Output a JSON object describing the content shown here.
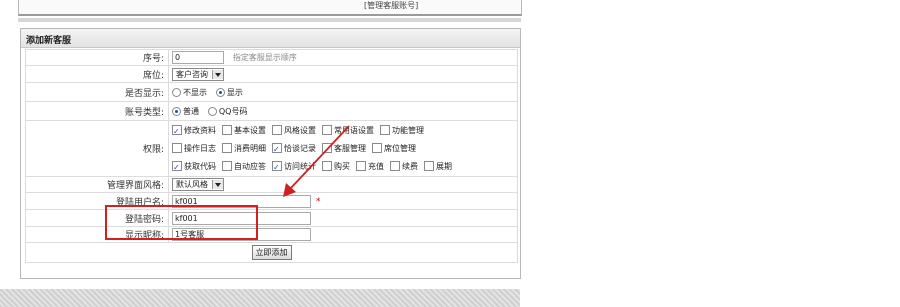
{
  "top": {
    "link": "[管理客服账号]"
  },
  "panel": {
    "title": "添加新客服"
  },
  "fields": {
    "seq": {
      "label": "序号:",
      "value": "0",
      "hint": "指定客服显示顺序"
    },
    "seat": {
      "label": "席位:",
      "value": "客户咨询"
    },
    "display": {
      "label": "是否显示:",
      "options": [
        "不显示",
        "显示"
      ],
      "selected": "显示"
    },
    "account_type": {
      "label": "账号类型:",
      "options": [
        "普通",
        "QQ号码"
      ],
      "selected": "普通"
    },
    "permissions": {
      "label": "权限:",
      "rows": [
        [
          {
            "text": "修改资料",
            "checked": true
          },
          {
            "text": "基本设置",
            "checked": false
          },
          {
            "text": "风格设置",
            "checked": false
          },
          {
            "text": "常用语设置",
            "checked": false
          },
          {
            "text": "功能管理",
            "checked": false
          }
        ],
        [
          {
            "text": "操作日志",
            "checked": false
          },
          {
            "text": "消费明细",
            "checked": false
          },
          {
            "text": "恰谈记录",
            "checked": true
          },
          {
            "text": "客服管理",
            "checked": false
          },
          {
            "text": "席位管理",
            "checked": false
          }
        ],
        [
          {
            "text": "获取代码",
            "checked": true
          },
          {
            "text": "自动应答",
            "checked": false
          },
          {
            "text": "访问统计",
            "checked": true
          },
          {
            "text": "购买",
            "checked": false
          },
          {
            "text": "充值",
            "checked": false
          },
          {
            "text": "续费",
            "checked": false
          },
          {
            "text": "展期",
            "checked": false
          }
        ]
      ]
    },
    "style": {
      "label": "管理界面风格:",
      "value": "默认风格"
    },
    "username": {
      "label": "登陆用户名:",
      "value": "kf001",
      "required": "*"
    },
    "password": {
      "label": "登陆密码:",
      "value": "kf001"
    },
    "nickname": {
      "label": "显示昵称:",
      "value": "1号客服"
    }
  },
  "submit": {
    "label": "立即添加"
  },
  "colors": {
    "annotation": "#d02020",
    "accent": "#1d4fb0"
  }
}
